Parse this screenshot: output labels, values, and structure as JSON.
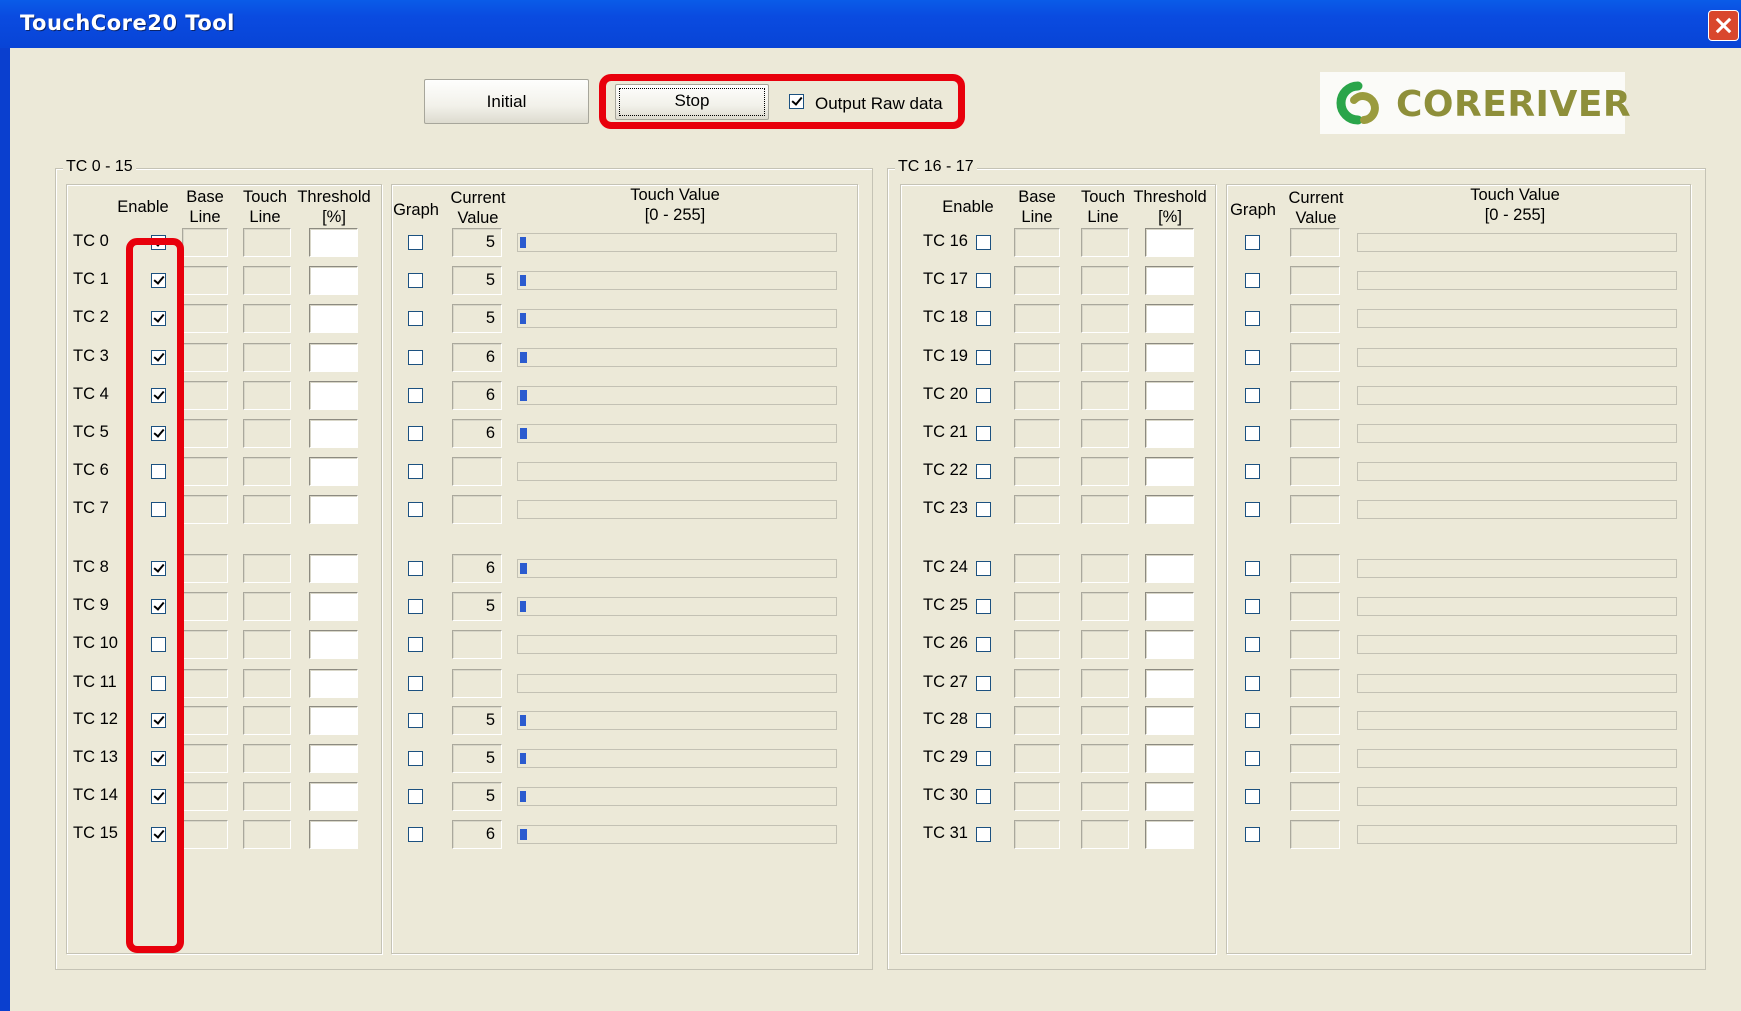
{
  "window": {
    "title": "TouchCore20 Tool"
  },
  "toolbar": {
    "initial_label": "Initial",
    "stop_label": "Stop",
    "output_raw_label": "Output Raw data",
    "output_raw_checked": true
  },
  "logo": {
    "text": "CORERIVER"
  },
  "headers": {
    "enable": "Enable",
    "base_line": "Base\nLine",
    "touch_line": "Touch\nLine",
    "threshold": "Threshold\n[%]",
    "graph": "Graph",
    "current_value": "Current\nValue",
    "touch_value": "Touch Value\n[0 - 255]"
  },
  "group_left": {
    "title": "TC 0 - 15",
    "rows": [
      {
        "label": "TC 0",
        "enabled": true,
        "value": "5",
        "level": 5
      },
      {
        "label": "TC 1",
        "enabled": true,
        "value": "5",
        "level": 5
      },
      {
        "label": "TC 2",
        "enabled": true,
        "value": "5",
        "level": 5
      },
      {
        "label": "TC 3",
        "enabled": true,
        "value": "6",
        "level": 6
      },
      {
        "label": "TC 4",
        "enabled": true,
        "value": "6",
        "level": 6
      },
      {
        "label": "TC 5",
        "enabled": true,
        "value": "6",
        "level": 6
      },
      {
        "label": "TC 6",
        "enabled": false,
        "value": "",
        "level": 0
      },
      {
        "label": "TC 7",
        "enabled": false,
        "value": "",
        "level": 0
      },
      {
        "label": "TC 8",
        "enabled": true,
        "value": "6",
        "level": 6
      },
      {
        "label": "TC 9",
        "enabled": true,
        "value": "5",
        "level": 5
      },
      {
        "label": "TC 10",
        "enabled": false,
        "value": "",
        "level": 0
      },
      {
        "label": "TC 11",
        "enabled": false,
        "value": "",
        "level": 0
      },
      {
        "label": "TC 12",
        "enabled": true,
        "value": "5",
        "level": 5
      },
      {
        "label": "TC 13",
        "enabled": true,
        "value": "5",
        "level": 5
      },
      {
        "label": "TC 14",
        "enabled": true,
        "value": "5",
        "level": 5
      },
      {
        "label": "TC 15",
        "enabled": true,
        "value": "6",
        "level": 6
      }
    ]
  },
  "group_right": {
    "title": "TC 16 - 17",
    "rows": [
      {
        "label": "TC 16",
        "enabled": false,
        "value": "",
        "level": 0
      },
      {
        "label": "TC 17",
        "enabled": false,
        "value": "",
        "level": 0
      },
      {
        "label": "TC 18",
        "enabled": false,
        "value": "",
        "level": 0
      },
      {
        "label": "TC 19",
        "enabled": false,
        "value": "",
        "level": 0
      },
      {
        "label": "TC 20",
        "enabled": false,
        "value": "",
        "level": 0
      },
      {
        "label": "TC 21",
        "enabled": false,
        "value": "",
        "level": 0
      },
      {
        "label": "TC 22",
        "enabled": false,
        "value": "",
        "level": 0
      },
      {
        "label": "TC 23",
        "enabled": false,
        "value": "",
        "level": 0
      },
      {
        "label": "TC 24",
        "enabled": false,
        "value": "",
        "level": 0
      },
      {
        "label": "TC 25",
        "enabled": false,
        "value": "",
        "level": 0
      },
      {
        "label": "TC 26",
        "enabled": false,
        "value": "",
        "level": 0
      },
      {
        "label": "TC 27",
        "enabled": false,
        "value": "",
        "level": 0
      },
      {
        "label": "TC 28",
        "enabled": false,
        "value": "",
        "level": 0
      },
      {
        "label": "TC 29",
        "enabled": false,
        "value": "",
        "level": 0
      },
      {
        "label": "TC 30",
        "enabled": false,
        "value": "",
        "level": 0
      },
      {
        "label": "TC 31",
        "enabled": false,
        "value": "",
        "level": 0
      }
    ]
  },
  "touch_value_max": 255,
  "colors": {
    "titlebar": "#0a4be0",
    "highlight": "#e8000c",
    "bar_fill": "#2b5bcf",
    "logo_text": "#8e8f3a"
  }
}
